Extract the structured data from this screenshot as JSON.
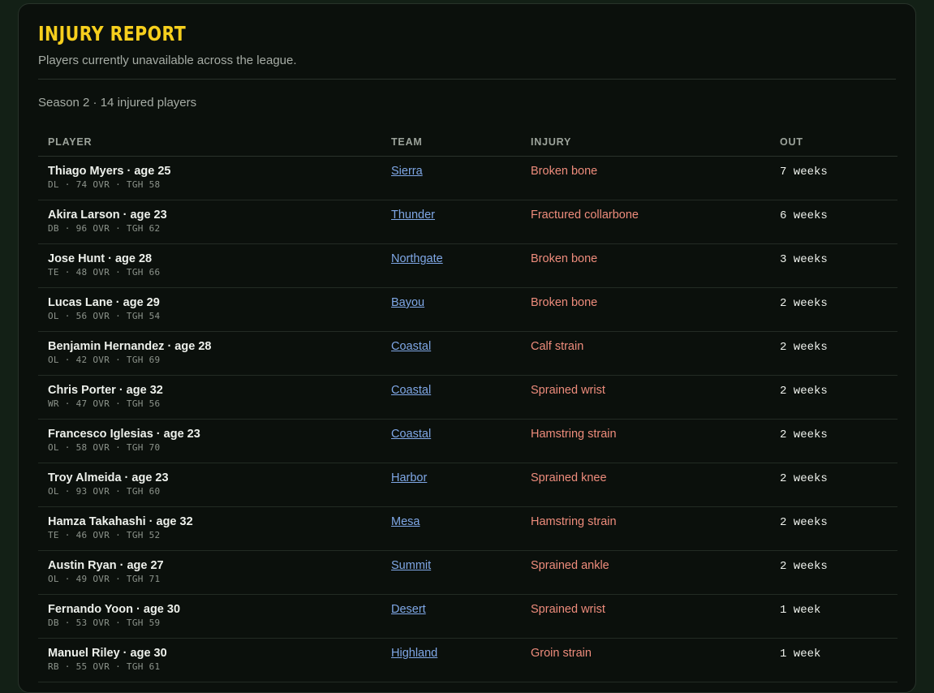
{
  "header": {
    "title": "Injury Report",
    "subtitle": "Players currently unavailable across the league.",
    "meta": "Season 2 · 14 injured players"
  },
  "table": {
    "columns": [
      "PLAYER",
      "TEAM",
      "INJURY",
      "OUT"
    ],
    "rows": [
      {
        "name": "Thiago Myers · age 25",
        "stats": "DL · 74 OVR · TGH 58",
        "team": "Sierra",
        "injury": "Broken bone",
        "out": "7 weeks"
      },
      {
        "name": "Akira Larson · age 23",
        "stats": "DB · 96 OVR · TGH 62",
        "team": "Thunder",
        "injury": "Fractured collarbone",
        "out": "6 weeks"
      },
      {
        "name": "Jose Hunt · age 28",
        "stats": "TE · 48 OVR · TGH 66",
        "team": "Northgate",
        "injury": "Broken bone",
        "out": "3 weeks"
      },
      {
        "name": "Lucas Lane · age 29",
        "stats": "OL · 56 OVR · TGH 54",
        "team": "Bayou",
        "injury": "Broken bone",
        "out": "2 weeks"
      },
      {
        "name": "Benjamin Hernandez · age 28",
        "stats": "OL · 42 OVR · TGH 69",
        "team": "Coastal",
        "injury": "Calf strain",
        "out": "2 weeks"
      },
      {
        "name": "Chris Porter · age 32",
        "stats": "WR · 47 OVR · TGH 56",
        "team": "Coastal",
        "injury": "Sprained wrist",
        "out": "2 weeks"
      },
      {
        "name": "Francesco Iglesias · age 23",
        "stats": "OL · 58 OVR · TGH 70",
        "team": "Coastal",
        "injury": "Hamstring strain",
        "out": "2 weeks"
      },
      {
        "name": "Troy Almeida · age 23",
        "stats": "OL · 93 OVR · TGH 60",
        "team": "Harbor",
        "injury": "Sprained knee",
        "out": "2 weeks"
      },
      {
        "name": "Hamza Takahashi · age 32",
        "stats": "TE · 46 OVR · TGH 52",
        "team": "Mesa",
        "injury": "Hamstring strain",
        "out": "2 weeks"
      },
      {
        "name": "Austin Ryan · age 27",
        "stats": "OL · 49 OVR · TGH 71",
        "team": "Summit",
        "injury": "Sprained ankle",
        "out": "2 weeks"
      },
      {
        "name": "Fernando Yoon · age 30",
        "stats": "DB · 53 OVR · TGH 59",
        "team": "Desert",
        "injury": "Sprained wrist",
        "out": "1 week"
      },
      {
        "name": "Manuel Riley · age 30",
        "stats": "RB · 55 OVR · TGH 61",
        "team": "Highland",
        "injury": "Groin strain",
        "out": "1 week"
      }
    ]
  },
  "colors": {
    "title": "#f6cf1d",
    "team_link": "#7fa7e6",
    "injury_text": "#ee8c7c",
    "panel_bg": "#0b100c"
  }
}
